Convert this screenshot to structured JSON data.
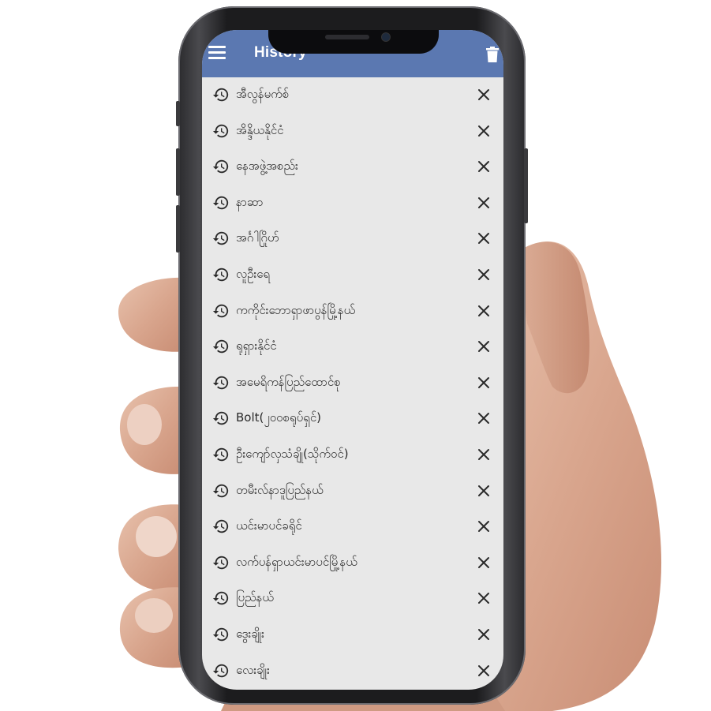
{
  "app_bar": {
    "title": "History",
    "menu_icon": "menu-icon",
    "delete_all_icon": "trash-icon",
    "color": "#5b78b1"
  },
  "history": {
    "item_icon": "history-icon",
    "remove_icon": "close-icon",
    "items": [
      {
        "label": "အီလွန်မက်စ်"
      },
      {
        "label": "အိန္ဒိယနိုင်ငံ"
      },
      {
        "label": "နေအဖွဲ့အစည်း"
      },
      {
        "label": "နာဆာ"
      },
      {
        "label": "အင်္ဂါဂြိုဟ်"
      },
      {
        "label": "လူဦးရေ"
      },
      {
        "label": "ကကိုင်းဘောရှာဖာပွန်မြို့နယ်"
      },
      {
        "label": "ရုရှားနိုင်ငံ"
      },
      {
        "label": "အမေရိကန်ပြည်ထောင်စု"
      },
      {
        "label": "Bolt(၂၀၀စရုပ်ရှင်)"
      },
      {
        "label": "ဦးကျော်လှသံချို(သိုက်ဝင်)"
      },
      {
        "label": "တမီးလ်နာဒူပြည်နယ်"
      },
      {
        "label": "ယင်းမာပင်ခရိုင်"
      },
      {
        "label": "လက်ပန်ရှာယင်းမာပင်မြို့နယ်"
      },
      {
        "label": "ပြည်နယ်"
      },
      {
        "label": "ဒွေးချိုး"
      },
      {
        "label": "လေးချိုး"
      }
    ]
  }
}
